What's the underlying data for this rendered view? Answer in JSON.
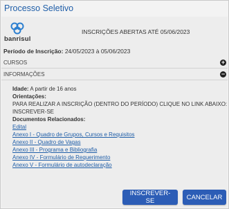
{
  "dialog": {
    "title": "Processo Seletivo"
  },
  "header": {
    "logo_text": "banrisul",
    "open_text": "INSCRIÇÕES ABERTAS ATÉ 05/06/2023",
    "period_label": "Período de Inscrição:",
    "period_value": "24/05/2023 à 05/06/2023"
  },
  "sections": {
    "cursos": {
      "label": "CURSOS",
      "toggle": "+"
    },
    "informacoes": {
      "label": "INFORMAÇÕES",
      "toggle": "−"
    }
  },
  "info": {
    "idade_label": "Idade:",
    "idade_value": "A partir de 16 anos",
    "orientacoes_label": "Orientações:",
    "orientacoes_text_1": "PARA REALIZAR A INSCRIÇÃO (DENTRO DO PERÍODO) CLIQUE NO LINK ABAIXO:",
    "orientacoes_text_2": "INSCREVER-SE",
    "documentos_label": "Documentos Relacionados:",
    "documents": [
      "Edital",
      "Anexo I - Quadro de Grupos, Cursos e Requisitos",
      "Anexo II - Quadro de Vagas",
      "Anexo III - Programa e Bibliografia",
      "Anexo IV - Formulário de Requerimento",
      "Anexo V - Formulário de autodeclaração"
    ]
  },
  "buttons": {
    "subscribe": "INSCREVER-SE",
    "cancel": "CANCELAR"
  },
  "colors": {
    "primary": "#2c5db6",
    "title": "#1f5ea8",
    "link": "#1f5ea8"
  },
  "icons": {
    "logo": "banrisul-logo-icon",
    "expand": "plus-circle-icon",
    "collapse": "minus-circle-icon"
  }
}
